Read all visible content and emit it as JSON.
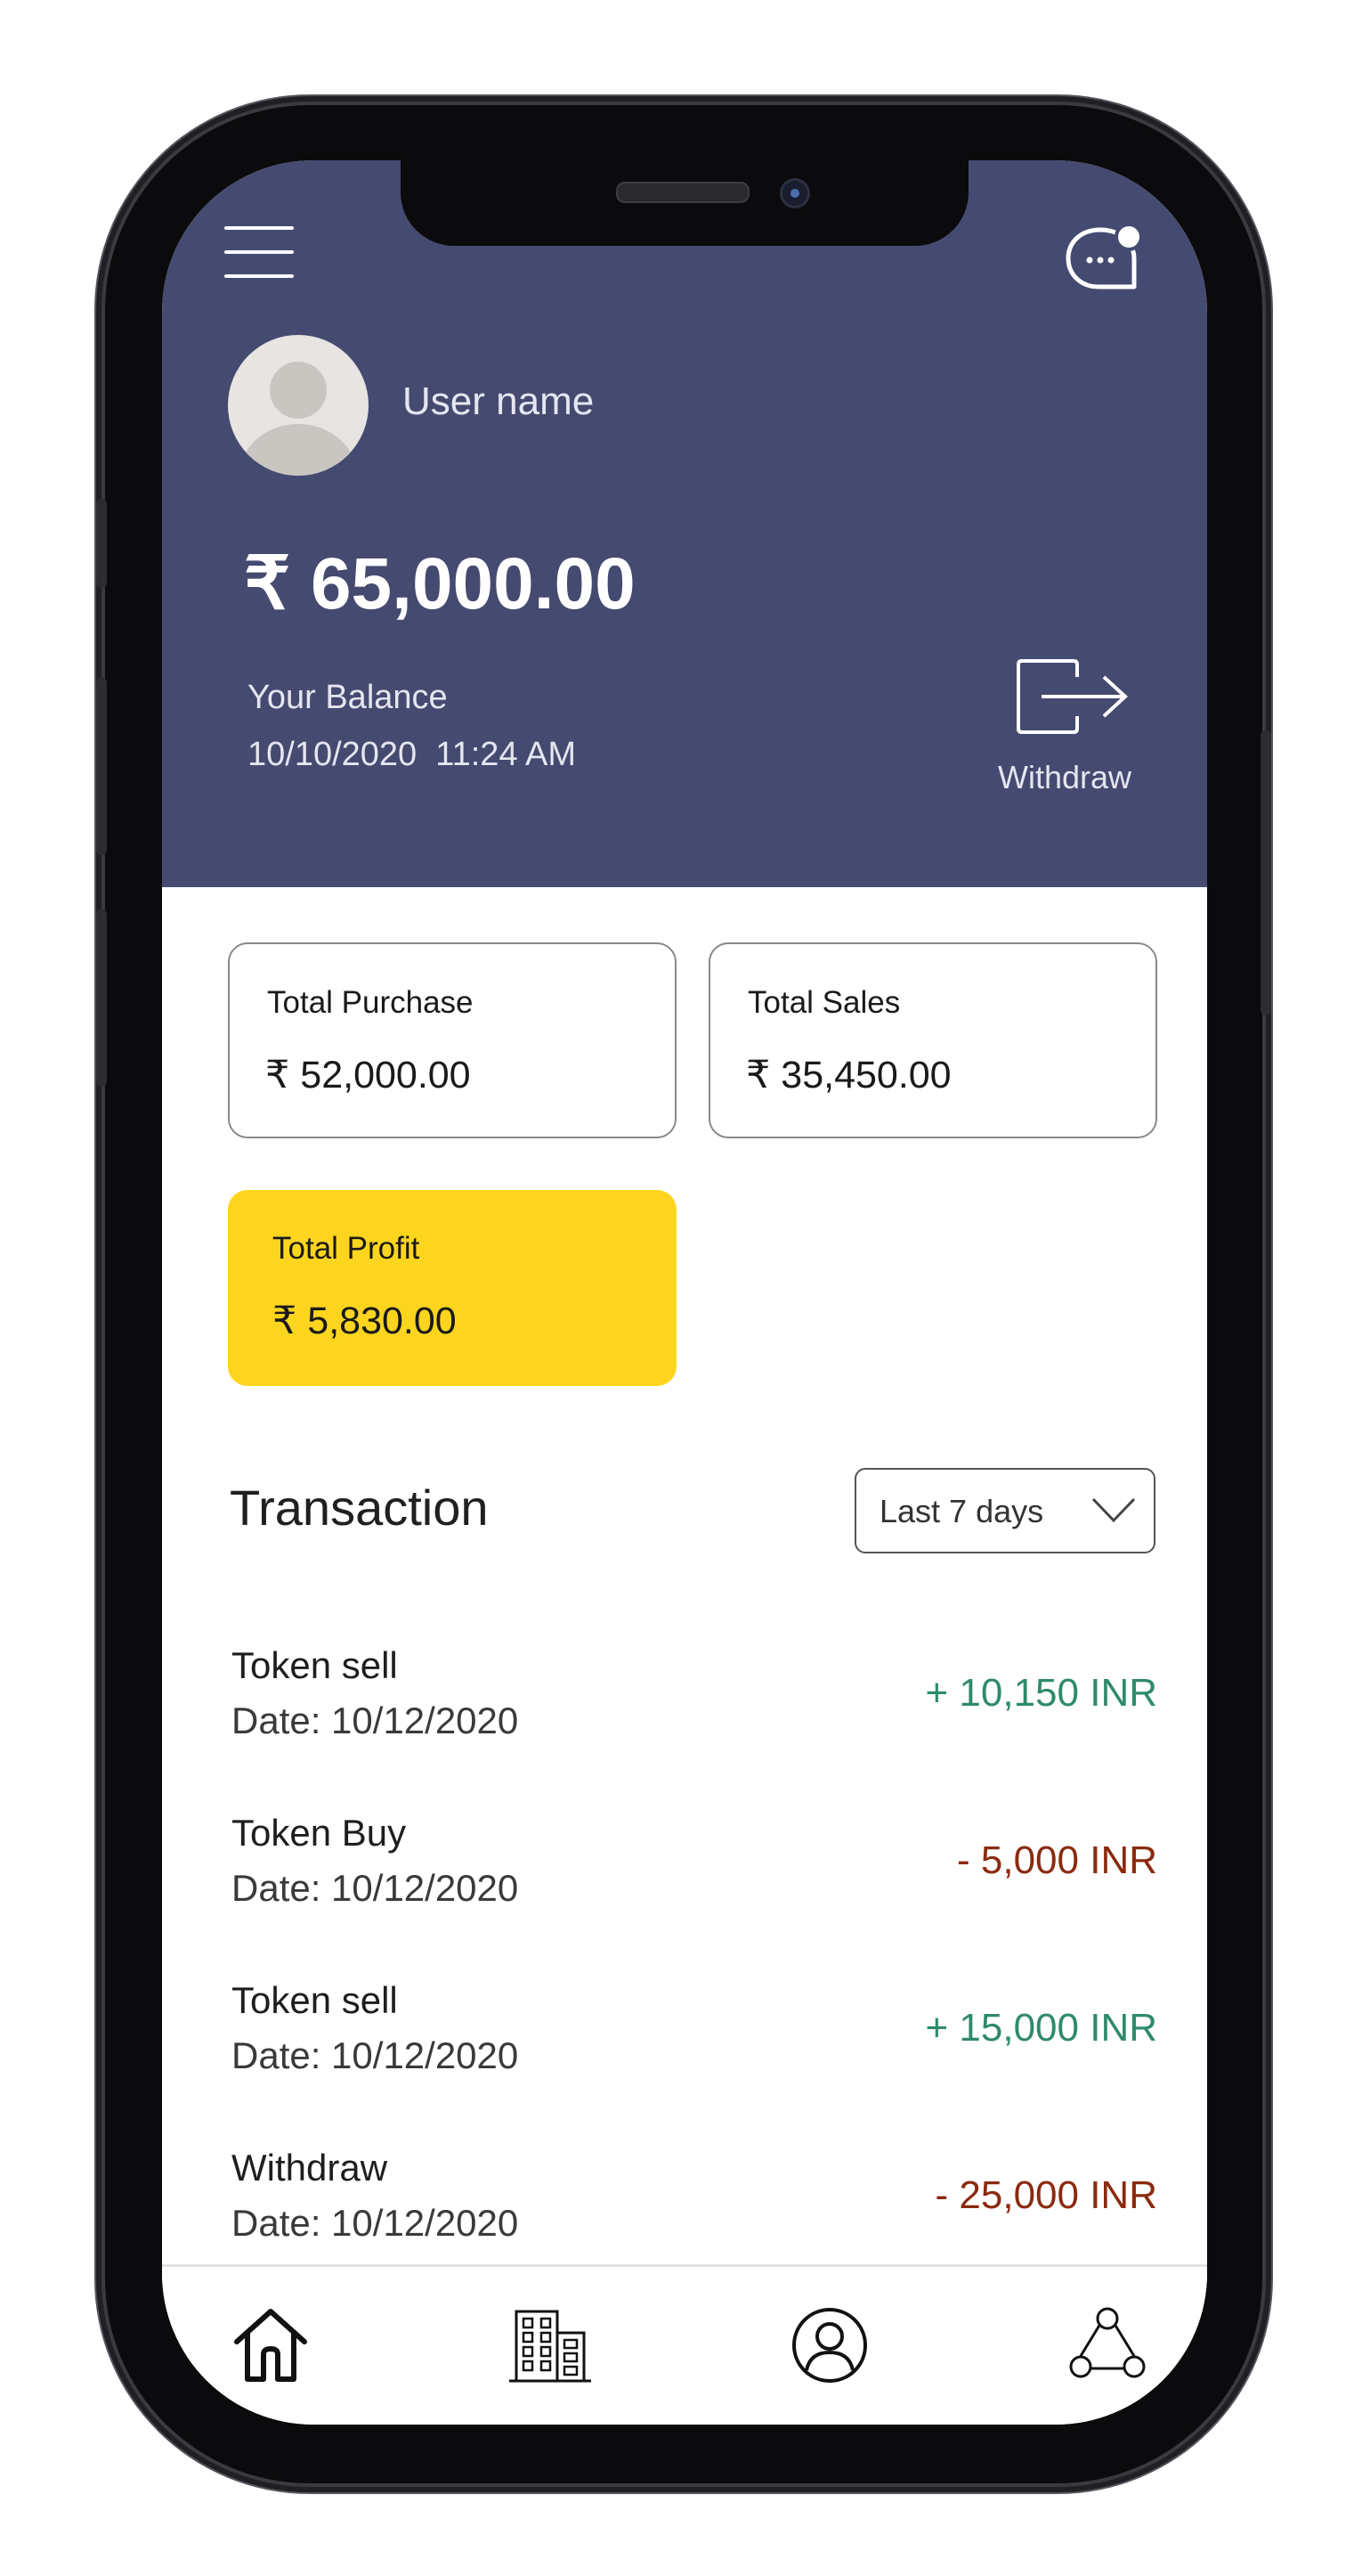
{
  "header": {
    "user_name": "User name",
    "balance": "₹ 65,000.00",
    "balance_label": "Your Balance",
    "balance_datetime": "10/10/2020  11:24 AM",
    "withdraw_label": "Withdraw",
    "menu_icon": "hamburger-menu-icon",
    "chat_icon": "chat-notification-icon"
  },
  "stats": {
    "purchase": {
      "label": "Total Purchase",
      "value": "₹ 52,000.00"
    },
    "sales": {
      "label": "Total Sales",
      "value": "₹ 35,450.00"
    },
    "profit": {
      "label": "Total Profit",
      "value": "₹ 5,830.00"
    }
  },
  "transactions": {
    "heading": "Transaction",
    "filter": "Last 7 days",
    "items": [
      {
        "type": "Token sell",
        "date": "Date: 10/12/2020",
        "amount": "+ 10,150 INR",
        "direction": "credit"
      },
      {
        "type": "Token Buy",
        "date": "Date: 10/12/2020",
        "amount": "- 5,000 INR",
        "direction": "debit"
      },
      {
        "type": "Token sell",
        "date": "Date: 10/12/2020",
        "amount": "+ 15,000 INR",
        "direction": "credit"
      },
      {
        "type": "Withdraw",
        "date": "Date: 10/12/2020",
        "amount": "- 25,000 INR",
        "direction": "debit"
      }
    ]
  },
  "bottom_nav": {
    "items": [
      "home-icon",
      "buildings-icon",
      "profile-icon",
      "network-icon"
    ]
  },
  "colors": {
    "header_bg": "#454a70",
    "profit_card": "#fdd51f",
    "credit": "#2f8a6d",
    "debit": "#8b2a0e"
  }
}
